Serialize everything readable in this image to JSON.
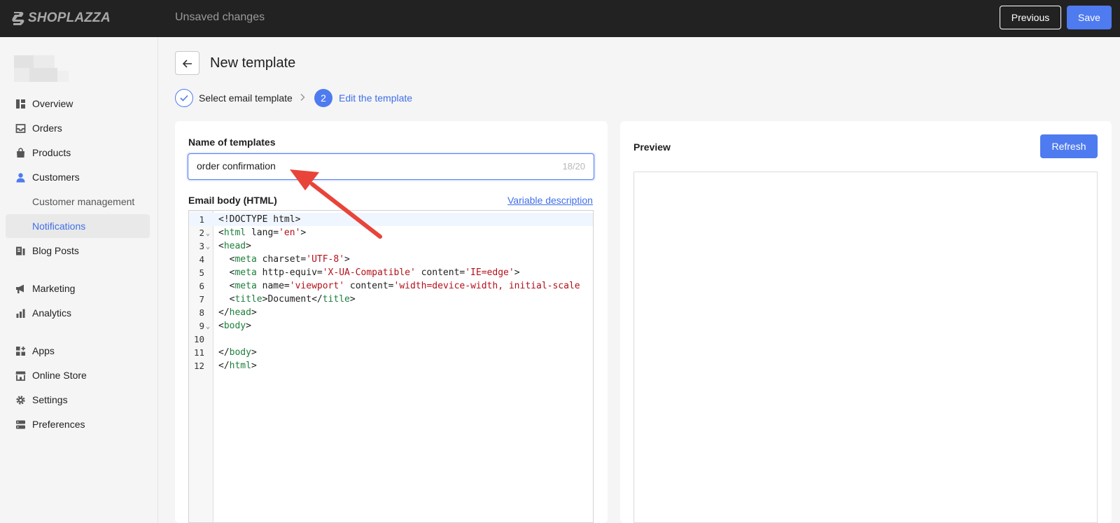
{
  "topbar": {
    "brand": "SHOPLAZZA",
    "status": "Unsaved changes",
    "previous_label": "Previous",
    "save_label": "Save"
  },
  "sidebar": {
    "items": [
      {
        "label": "Overview",
        "icon": "overview-icon"
      },
      {
        "label": "Orders",
        "icon": "inbox-icon"
      },
      {
        "label": "Products",
        "icon": "bag-icon"
      },
      {
        "label": "Customers",
        "icon": "user-icon"
      },
      {
        "label": "Customer management"
      },
      {
        "label": "Notifications"
      },
      {
        "label": "Blog Posts",
        "icon": "blog-icon"
      },
      {
        "label": "Marketing",
        "icon": "megaphone-icon"
      },
      {
        "label": "Analytics",
        "icon": "bar-chart-icon"
      },
      {
        "label": "Apps",
        "icon": "apps-icon"
      },
      {
        "label": "Online Store",
        "icon": "store-icon"
      },
      {
        "label": "Settings",
        "icon": "gear-icon"
      },
      {
        "label": "Preferences",
        "icon": "preferences-icon"
      }
    ],
    "active": "Notifications"
  },
  "page": {
    "title": "New template",
    "steps": [
      {
        "label": "Select email template",
        "state": "done"
      },
      {
        "label": "Edit the template",
        "number": "2",
        "state": "current"
      }
    ]
  },
  "form": {
    "name_label": "Name of templates",
    "name_value": "order confirmation",
    "name_count": "18/20",
    "body_label": "Email body (HTML)",
    "variable_link": "Variable description"
  },
  "editor": {
    "lines": [
      {
        "n": "1",
        "fold": "",
        "tokens": [
          {
            "t": "<!DOCTYPE html>",
            "c": "plain"
          }
        ]
      },
      {
        "n": "2",
        "fold": "⌄",
        "tokens": [
          {
            "t": "<",
            "c": "plain"
          },
          {
            "t": "html",
            "c": "tag"
          },
          {
            "t": " lang=",
            "c": "plain"
          },
          {
            "t": "'en'",
            "c": "str"
          },
          {
            "t": ">",
            "c": "plain"
          }
        ]
      },
      {
        "n": "3",
        "fold": "⌄",
        "tokens": [
          {
            "t": "<",
            "c": "plain"
          },
          {
            "t": "head",
            "c": "tag"
          },
          {
            "t": ">",
            "c": "plain"
          }
        ]
      },
      {
        "n": "4",
        "fold": "",
        "tokens": [
          {
            "t": "  <",
            "c": "plain"
          },
          {
            "t": "meta",
            "c": "tag"
          },
          {
            "t": " charset=",
            "c": "plain"
          },
          {
            "t": "'UTF-8'",
            "c": "str"
          },
          {
            "t": ">",
            "c": "plain"
          }
        ]
      },
      {
        "n": "5",
        "fold": "",
        "tokens": [
          {
            "t": "  <",
            "c": "plain"
          },
          {
            "t": "meta",
            "c": "tag"
          },
          {
            "t": " http-equiv=",
            "c": "plain"
          },
          {
            "t": "'X-UA-Compatible'",
            "c": "str"
          },
          {
            "t": " content=",
            "c": "plain"
          },
          {
            "t": "'IE=edge'",
            "c": "str"
          },
          {
            "t": ">",
            "c": "plain"
          }
        ]
      },
      {
        "n": "6",
        "fold": "",
        "tokens": [
          {
            "t": "  <",
            "c": "plain"
          },
          {
            "t": "meta",
            "c": "tag"
          },
          {
            "t": " name=",
            "c": "plain"
          },
          {
            "t": "'viewport'",
            "c": "str"
          },
          {
            "t": " content=",
            "c": "plain"
          },
          {
            "t": "'width=device-width, initial-scale",
            "c": "str"
          }
        ]
      },
      {
        "n": "7",
        "fold": "",
        "tokens": [
          {
            "t": "  <",
            "c": "plain"
          },
          {
            "t": "title",
            "c": "tag"
          },
          {
            "t": ">Document</",
            "c": "plain"
          },
          {
            "t": "title",
            "c": "tag"
          },
          {
            "t": ">",
            "c": "plain"
          }
        ]
      },
      {
        "n": "8",
        "fold": "",
        "tokens": [
          {
            "t": "</",
            "c": "plain"
          },
          {
            "t": "head",
            "c": "tag"
          },
          {
            "t": ">",
            "c": "plain"
          }
        ]
      },
      {
        "n": "9",
        "fold": "⌄",
        "tokens": [
          {
            "t": "<",
            "c": "plain"
          },
          {
            "t": "body",
            "c": "tag"
          },
          {
            "t": ">",
            "c": "plain"
          }
        ]
      },
      {
        "n": "10",
        "fold": "",
        "tokens": []
      },
      {
        "n": "11",
        "fold": "",
        "tokens": [
          {
            "t": "</",
            "c": "plain"
          },
          {
            "t": "body",
            "c": "tag"
          },
          {
            "t": ">",
            "c": "plain"
          }
        ]
      },
      {
        "n": "12",
        "fold": "",
        "tokens": [
          {
            "t": "</",
            "c": "plain"
          },
          {
            "t": "html",
            "c": "tag"
          },
          {
            "t": ">",
            "c": "plain"
          }
        ]
      }
    ]
  },
  "preview": {
    "label": "Preview",
    "refresh_label": "Refresh"
  },
  "colors": {
    "accent": "#4f7bf0",
    "topbar": "#222222",
    "annotation": "#e8443a"
  }
}
